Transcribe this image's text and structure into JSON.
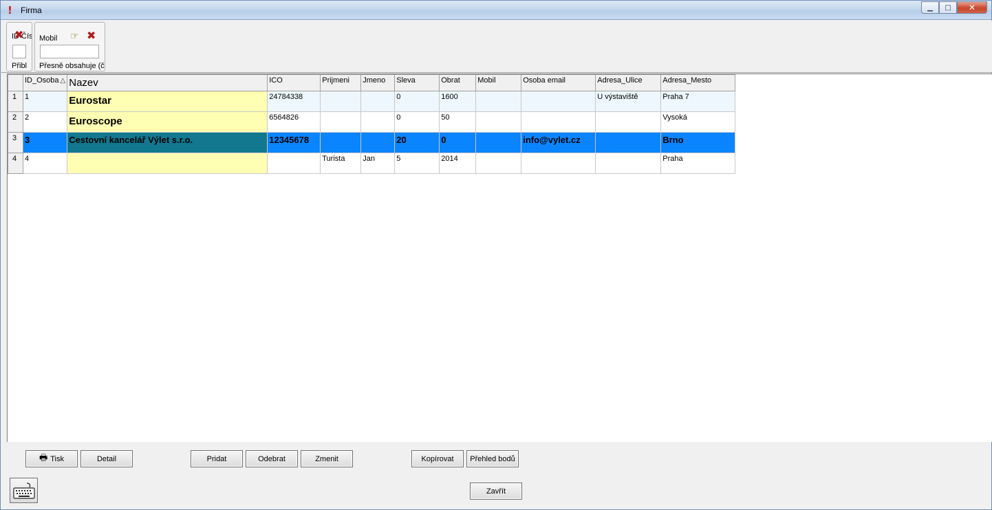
{
  "window": {
    "title": "Firma"
  },
  "filters": [
    {
      "label": "ID_Osoba",
      "label_visible": "ID Čís",
      "mode": "Přibl",
      "value": ""
    },
    {
      "label": "Mobil",
      "mode": "Přesně obsahuje (či",
      "value": ""
    }
  ],
  "grid": {
    "columns": [
      "ID_Osoba",
      "Nazev",
      "ICO",
      "Prijmeni",
      "Jmeno",
      "Sleva",
      "Obrat",
      "Mobil",
      "Osoba email",
      "Adresa_Ulice",
      "Adresa_Mesto"
    ],
    "rows": [
      {
        "num": "1",
        "cells": [
          "1",
          "Eurostar",
          "24784338",
          "",
          "",
          "0",
          "1600",
          "",
          "",
          "U výstaviště",
          "Praha 7"
        ]
      },
      {
        "num": "2",
        "cells": [
          "2",
          "Euroscope",
          "6564826",
          "",
          "",
          "0",
          "50",
          "",
          "",
          "",
          "Vysoká"
        ]
      },
      {
        "num": "3",
        "cells": [
          "3",
          "Cestovní kancelář Výlet s.r.o.",
          "12345678",
          "",
          "",
          "20",
          "0",
          "",
          "info@vylet.cz",
          "",
          "Brno"
        ]
      },
      {
        "num": "4",
        "cells": [
          "4",
          "",
          "",
          "Turista",
          "Jan",
          "5",
          "2014",
          "",
          "",
          "",
          "Praha"
        ]
      }
    ],
    "selected_row": "3"
  },
  "buttons": {
    "tisk": "Tisk",
    "detail": "Detail",
    "pridat": "Pridat",
    "odebrat": "Odebrat",
    "zmenit": "Zmenit",
    "kopirovat": "Kopírovat",
    "prehled": "Přehled bodů",
    "zavrit": "Zavřít"
  },
  "icons": {
    "window": "exclamation-icon",
    "clear_filter": "close-x-icon",
    "apply_filter": "pointing-hand-icon",
    "print": "printer-icon",
    "keyboard": "keyboard-icon",
    "sort": "sort-triangle-icon"
  },
  "colors": {
    "selected_row": "#0a84ff",
    "selected_name_cell": "#11788f",
    "name_column": "#ffffb3",
    "first_row": "#eef7fd",
    "close_button": "#c8452b"
  }
}
